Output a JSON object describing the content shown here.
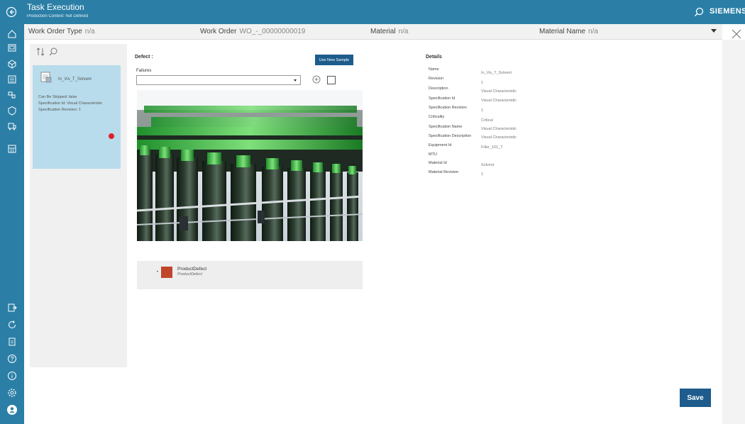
{
  "app": {
    "title": "Task Execution",
    "subtitle": "Production Context: Not Defined",
    "brand": "SIEMENS"
  },
  "header": {
    "work_order_type_label": "Work Order Type",
    "work_order_type_value": "n/a",
    "work_order_label": "Work Order",
    "work_order_value": "WO_-_00000000019",
    "material_label": "Material",
    "material_value": "n/a",
    "material_name_label": "Material Name",
    "material_name_value": "n/a"
  },
  "task_card": {
    "name": "In_Vis_T_Solvent",
    "lines": [
      "Can Be Skipped: false",
      "Specification Id: Visual Characteristic",
      "Specification Revision: 1"
    ],
    "status_color": "#e0202c"
  },
  "defect": {
    "title": "Defect :",
    "use_new_sample_label": "Use New Sample",
    "failures_label": "Failures",
    "failures_value": "",
    "product_defect_name": "ProductDefect",
    "product_defect_sub": "ProductDefect",
    "product_defect_color": "#c0462b"
  },
  "details": {
    "title": "Details",
    "rows": [
      {
        "label": "Name",
        "value": "In_Vis_T_Solvent"
      },
      {
        "label": "Revision",
        "value": "1"
      },
      {
        "label": "Description",
        "value": "Visual Characteristic"
      },
      {
        "label": "Specification Id",
        "value": "Visual Characteristic"
      },
      {
        "label": "Specification Revision",
        "value": "1"
      },
      {
        "label": "Criticality",
        "value": "Critical"
      },
      {
        "label": "Specification Name",
        "value": "Visual Characteristic"
      },
      {
        "label": "Specification Description",
        "value": "Visual Characteristic"
      },
      {
        "label": "Equipment Id",
        "value": "Filler_101_T"
      },
      {
        "label": "MTU",
        "value": ""
      },
      {
        "label": "Material Id",
        "value": "Solvent"
      },
      {
        "label": "Material Revision",
        "value": "1"
      }
    ]
  },
  "actions": {
    "save_label": "Save"
  },
  "icons": {
    "rail_top": [
      "home-icon",
      "monitor-icon",
      "cube-icon",
      "list-icon",
      "tag-icon",
      "shield-icon",
      "truck-icon",
      "grid-icon"
    ],
    "rail_bottom": [
      "export-icon",
      "refresh-icon",
      "clipboard-icon",
      "help-icon",
      "info-icon",
      "settings-icon",
      "user-avatar-icon"
    ]
  },
  "colors": {
    "accent": "#2b7fa6",
    "button": "#1d5c8c",
    "card": "#b8dcec"
  }
}
